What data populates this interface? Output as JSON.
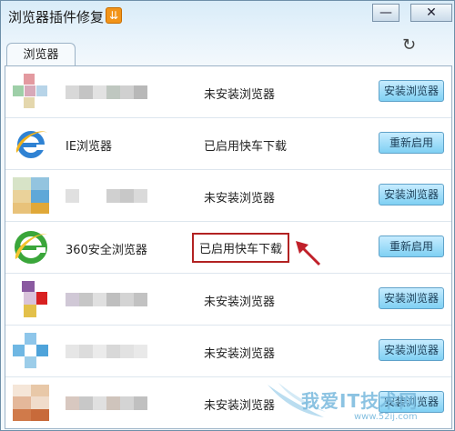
{
  "window": {
    "title": "浏览器插件修复",
    "badge_icon": "download-arrow-icon",
    "minimize_glyph": "—",
    "close_glyph": "✕"
  },
  "toolbar": {
    "refresh_icon": "refresh-icon",
    "refresh_glyph": "↻"
  },
  "tabs": [
    {
      "label": "浏览器"
    }
  ],
  "rows": [
    {
      "name": "",
      "status": "未安装浏览器",
      "button": "安装浏览器",
      "logo": "blurred-logo"
    },
    {
      "name": "IE浏览器",
      "status": "已启用快车下载",
      "button": "重新启用",
      "logo": "ie-icon"
    },
    {
      "name": "",
      "status": "未安装浏览器",
      "button": "安装浏览器",
      "logo": "blurred-logo"
    },
    {
      "name": "360安全浏览器",
      "status": "已启用快车下载",
      "button": "重新启用",
      "logo": "360-browser-icon",
      "highlighted": true
    },
    {
      "name": "",
      "status": "未安装浏览器",
      "button": "安装浏览器",
      "logo": "blurred-logo"
    },
    {
      "name": "",
      "status": "未安装浏览器",
      "button": "安装浏览器",
      "logo": "blurred-logo"
    },
    {
      "name": "",
      "status": "未安装浏览器",
      "button": "安装浏览器",
      "logo": "blurred-logo"
    }
  ],
  "watermark": {
    "text": "我爱IT技术网",
    "url": "www.52ij.com"
  },
  "colors": {
    "highlight_border": "#b22222",
    "button_top": "#c7ecff",
    "button_bottom": "#7fd0f3",
    "panel_border": "#9bb2c6"
  }
}
